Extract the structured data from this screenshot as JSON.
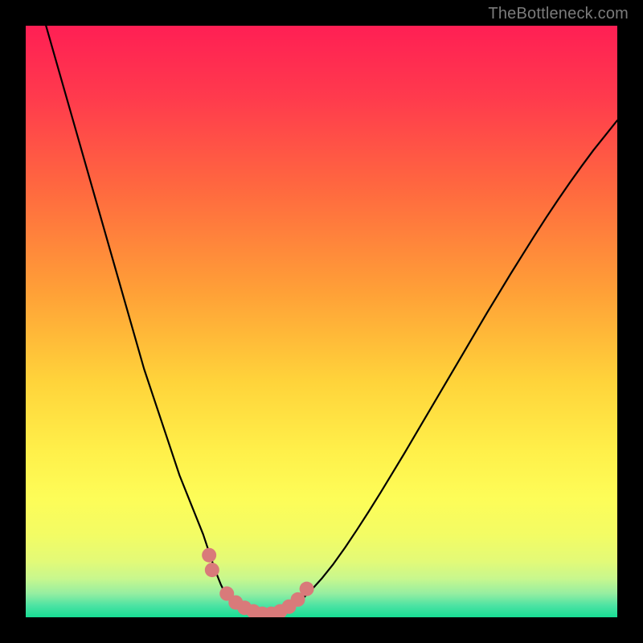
{
  "watermark": "TheBottleneck.com",
  "colors": {
    "frame": "#000000",
    "curve": "#000000",
    "fit_marker": "#d97a7a",
    "gradient_stops": [
      {
        "offset": 0.0,
        "color": "#ff1f54"
      },
      {
        "offset": 0.12,
        "color": "#ff3a4d"
      },
      {
        "offset": 0.28,
        "color": "#ff6a3f"
      },
      {
        "offset": 0.45,
        "color": "#ffa037"
      },
      {
        "offset": 0.6,
        "color": "#ffd33a"
      },
      {
        "offset": 0.72,
        "color": "#fff04a"
      },
      {
        "offset": 0.8,
        "color": "#fdfd58"
      },
      {
        "offset": 0.86,
        "color": "#f3fc64"
      },
      {
        "offset": 0.905,
        "color": "#e3fa77"
      },
      {
        "offset": 0.935,
        "color": "#c7f78e"
      },
      {
        "offset": 0.96,
        "color": "#95eea1"
      },
      {
        "offset": 0.98,
        "color": "#4de3a3"
      },
      {
        "offset": 1.0,
        "color": "#17dd94"
      }
    ]
  },
  "chart_data": {
    "type": "line",
    "title": "",
    "xlabel": "",
    "ylabel": "",
    "xlim": [
      0,
      100
    ],
    "ylim": [
      0,
      100
    ],
    "grid": false,
    "legend": false,
    "note": "Bottleneck-style curve; x≈component balance position (0–100), y≈bottleneck % (0 best, 100 worst). Background color encodes y (red→green).",
    "x": [
      0,
      2,
      4,
      6,
      8,
      10,
      12,
      14,
      16,
      18,
      20,
      22,
      24,
      26,
      28,
      30,
      31,
      32,
      33,
      34,
      36,
      38,
      40,
      42,
      44,
      46,
      48,
      50,
      52,
      54,
      56,
      58,
      60,
      62,
      64,
      66,
      68,
      70,
      72,
      74,
      76,
      78,
      80,
      82,
      84,
      86,
      88,
      90,
      92,
      94,
      96,
      98,
      100
    ],
    "y": [
      112,
      105,
      98,
      91,
      84,
      77,
      70,
      63,
      56,
      49,
      42,
      36,
      30,
      24,
      19,
      14,
      11,
      8,
      5.5,
      3.5,
      1.8,
      0.9,
      0.5,
      0.5,
      1.1,
      2.4,
      4.3,
      6.5,
      9.0,
      11.8,
      14.8,
      17.9,
      21.1,
      24.4,
      27.7,
      31.1,
      34.5,
      37.9,
      41.3,
      44.7,
      48.1,
      51.5,
      54.8,
      58.1,
      61.3,
      64.5,
      67.6,
      70.6,
      73.5,
      76.3,
      79.0,
      81.5,
      84.0
    ],
    "fit_markers_x": [
      31.0,
      31.5,
      34.0,
      35.5,
      37.0,
      38.5,
      40.0,
      41.5,
      43.0,
      44.5,
      46.0,
      47.5
    ],
    "fit_markers_y": [
      10.5,
      8.0,
      4.0,
      2.5,
      1.6,
      1.0,
      0.6,
      0.6,
      1.0,
      1.8,
      3.0,
      4.8
    ],
    "optimum_x": 40.5,
    "optimum_y": 0.5
  }
}
